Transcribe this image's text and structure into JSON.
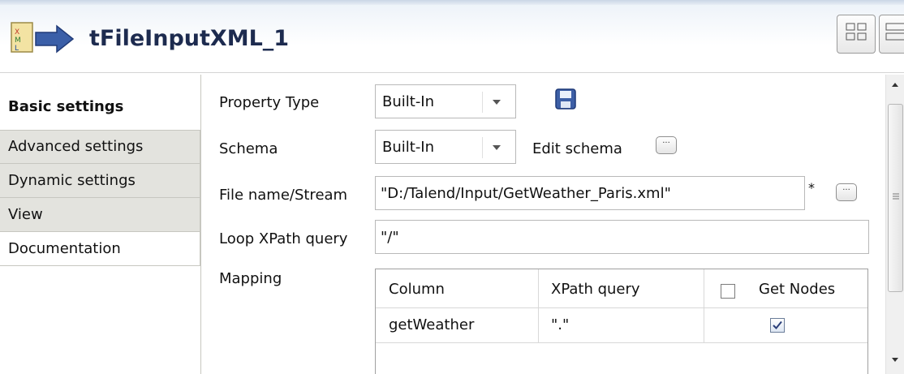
{
  "header": {
    "title": "tFileInputXML_1"
  },
  "sidebar": {
    "tabs": [
      {
        "label": "Basic settings",
        "active": true
      },
      {
        "label": "Advanced settings",
        "active": false
      },
      {
        "label": "Dynamic settings",
        "active": false
      },
      {
        "label": "View",
        "active": false
      },
      {
        "label": "Documentation",
        "active": false
      }
    ]
  },
  "form": {
    "property_type": {
      "label": "Property Type",
      "value": "Built-In"
    },
    "schema": {
      "label": "Schema",
      "value": "Built-In",
      "edit_label": "Edit schema"
    },
    "file_name": {
      "label": "File name/Stream",
      "value": "\"D:/Talend/Input/GetWeather_Paris.xml\"",
      "required_marker": "*"
    },
    "loop_xpath": {
      "label": "Loop XPath query",
      "value": "\"/\""
    },
    "mapping": {
      "label": "Mapping",
      "columns": [
        "Column",
        "XPath query",
        "Get Nodes"
      ],
      "rows": [
        {
          "column": "getWeather",
          "xpath": "\".\"",
          "get_nodes": true
        }
      ]
    }
  },
  "icons": {
    "component": "xml-file-arrow-icon",
    "save": "floppy-disk-icon",
    "dots": "ellipsis-icon"
  },
  "colors": {
    "title": "#1d2b4f",
    "tab_inactive": "#e3e3de",
    "accent": "#3b5fa8"
  }
}
